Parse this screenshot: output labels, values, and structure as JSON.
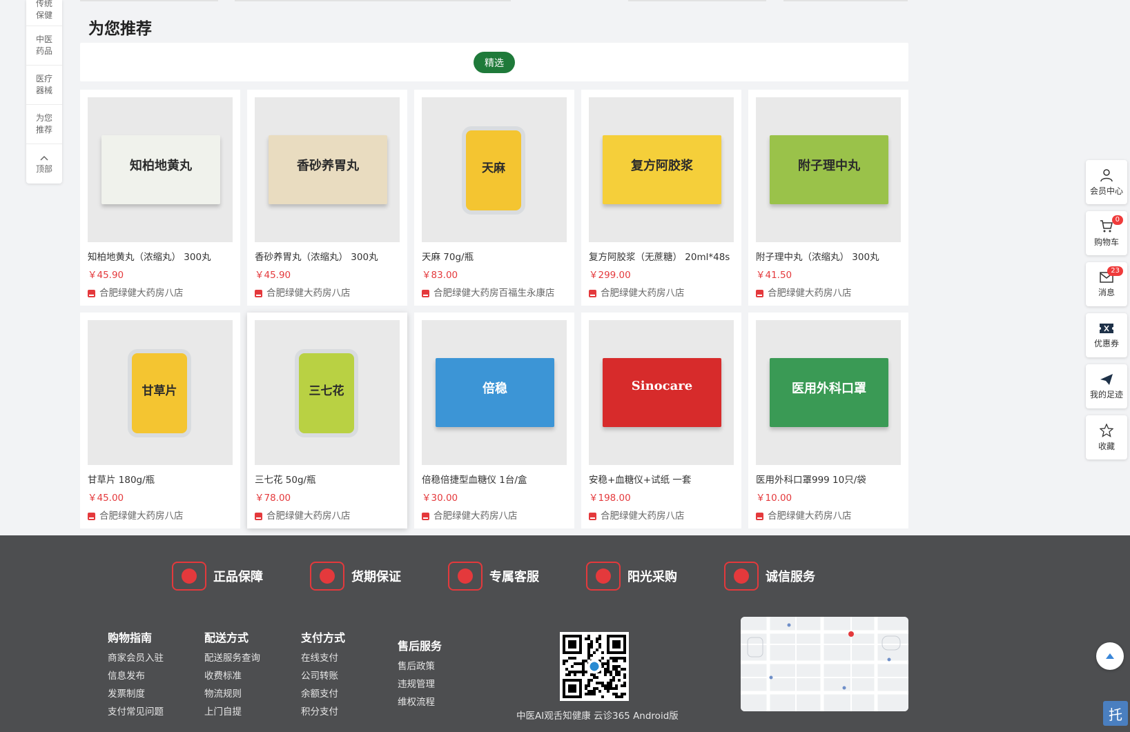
{
  "left_nav": {
    "items": [
      "传统保健",
      "中医药品",
      "医疗器械",
      "为您推荐"
    ],
    "top_arrow": "^",
    "top_label": "顶部"
  },
  "section": {
    "title": "为您推荐",
    "tab": "精选"
  },
  "products": [
    {
      "name": "知柏地黄丸（浓缩丸） 300丸",
      "price": "￥45.90",
      "shop": "合肥绿健大药房八店",
      "box_text": "知柏地黄丸",
      "color": "#f0f2ec"
    },
    {
      "name": "香砂养胃丸（浓缩丸） 300丸",
      "price": "￥45.90",
      "shop": "合肥绿健大药房八店",
      "box_text": "香砂养胃丸",
      "color": "#e9dcc0"
    },
    {
      "name": "天麻 70g/瓶",
      "price": "￥83.00",
      "shop": "合肥绿健大药房百福生永康店",
      "box_text": "天麻",
      "color": "#f4c531"
    },
    {
      "name": "复方阿胶浆（无蔗糖） 20ml*48s",
      "price": "￥299.00",
      "shop": "合肥绿健大药房八店",
      "box_text": "复方阿胶浆",
      "color": "#f5cf3a"
    },
    {
      "name": "附子理中丸（浓缩丸） 300丸",
      "price": "￥41.50",
      "shop": "合肥绿健大药房八店",
      "box_text": "附子理中丸",
      "color": "#9ac24a"
    },
    {
      "name": "甘草片 180g/瓶",
      "price": "￥45.00",
      "shop": "合肥绿健大药房八店",
      "box_text": "甘草片",
      "color": "#f4c531"
    },
    {
      "name": "三七花 50g/瓶",
      "price": "￥78.00",
      "shop": "合肥绿健大药房八店",
      "box_text": "三七花",
      "color": "#b9d143"
    },
    {
      "name": "倍稳倍捷型血糖仪 1台/盒",
      "price": "￥30.00",
      "shop": "合肥绿健大药房八店",
      "box_text": "倍稳",
      "color": "#3c95d6"
    },
    {
      "name": "安稳+血糖仪+试纸 一套",
      "price": "￥198.00",
      "shop": "合肥绿健大药房八店",
      "box_text": "Sinocare",
      "color": "#d72b2b"
    },
    {
      "name": "医用外科口罩999 10只/袋",
      "price": "￥10.00",
      "shop": "合肥绿健大药房八店",
      "box_text": "医用外科口罩",
      "color": "#3a9a55"
    }
  ],
  "right_bar": [
    {
      "label": "会员中心",
      "icon": "user-icon"
    },
    {
      "label": "购物车",
      "icon": "cart-icon",
      "badge": "0"
    },
    {
      "label": "消息",
      "icon": "mail-icon",
      "badge": "23"
    },
    {
      "label": "优惠券",
      "icon": "ticket-icon"
    },
    {
      "label": "我的足迹",
      "icon": "send-icon"
    },
    {
      "label": "收藏",
      "icon": "star-icon"
    }
  ],
  "guarantees": [
    "正品保障",
    "货期保证",
    "专属客服",
    "阳光采购",
    "诚信服务"
  ],
  "footer_cols": [
    {
      "title": "购物指南",
      "links": [
        "商家会员入驻",
        "信息发布",
        "发票制度",
        "支付常见问题"
      ]
    },
    {
      "title": "配送方式",
      "links": [
        "配送服务查询",
        "收费标准",
        "物流规则",
        "上门自提"
      ]
    },
    {
      "title": "支付方式",
      "links": [
        "在线支付",
        "公司转账",
        "余额支付",
        "积分支付"
      ]
    },
    {
      "title": "售后服务",
      "links": [
        "售后政策",
        "违规管理",
        "维权流程"
      ]
    }
  ],
  "qr_caption": "中医AI观舌知健康 云诊365 Android版",
  "chat_label": "托",
  "colors": {
    "accent_green": "#1f7a3a",
    "price_red": "#e4393c",
    "footer_bg": "#4d4e50"
  }
}
